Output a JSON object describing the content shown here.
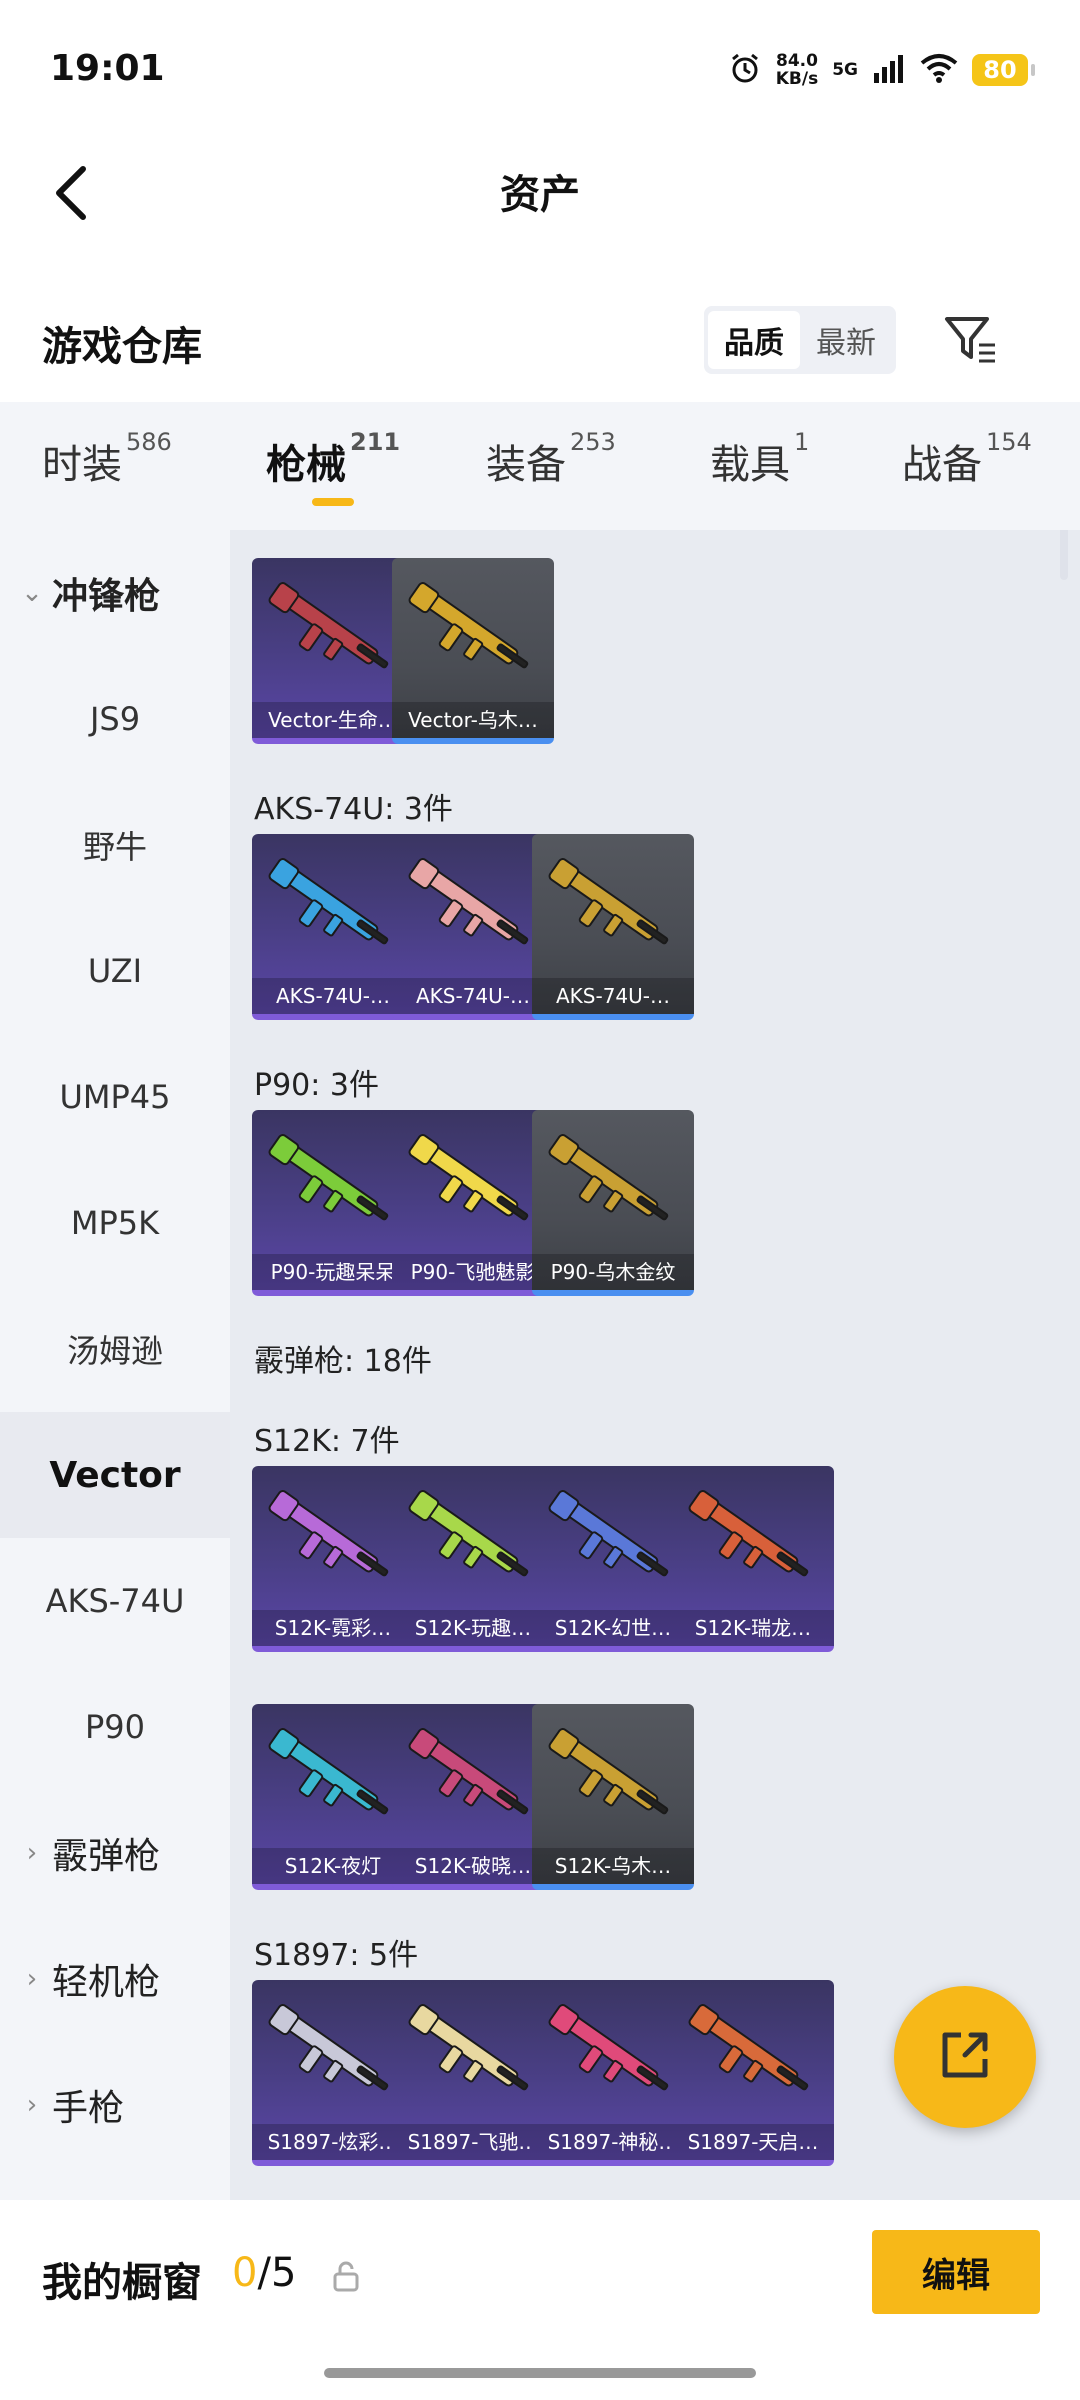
{
  "status_bar": {
    "time": "19:01",
    "net_speed_value": "84.0",
    "net_speed_unit": "KB/s",
    "network": "5G",
    "battery": "80",
    "icons": [
      "alarm-icon",
      "signal-icon",
      "wifi-icon",
      "battery-icon"
    ]
  },
  "header": {
    "title": "资产",
    "back_icon": "chevron-left-icon"
  },
  "warehouse": {
    "title": "游戏仓库",
    "sort_options": [
      "品质",
      "最新"
    ],
    "sort_active": "品质",
    "filter_icon": "filter-icon"
  },
  "tabs": [
    {
      "label": "时装",
      "count": "586"
    },
    {
      "label": "枪械",
      "count": "211",
      "active": true
    },
    {
      "label": "装备",
      "count": "253"
    },
    {
      "label": "载具",
      "count": "1"
    },
    {
      "label": "战备",
      "count": "154"
    }
  ],
  "sidebar": {
    "items": [
      {
        "label": "冲锋枪",
        "type": "group-expanded"
      },
      {
        "label": "JS9"
      },
      {
        "label": "野牛"
      },
      {
        "label": "UZI"
      },
      {
        "label": "UMP45"
      },
      {
        "label": "MP5K"
      },
      {
        "label": "汤姆逊"
      },
      {
        "label": "Vector",
        "selected": true
      },
      {
        "label": "AKS-74U"
      },
      {
        "label": "P90"
      },
      {
        "label": "霰弹枪",
        "type": "group-collapsed"
      },
      {
        "label": "轻机枪",
        "type": "group-collapsed"
      },
      {
        "label": "手枪",
        "type": "group-collapsed"
      }
    ]
  },
  "groups": [
    {
      "label": "",
      "items": [
        {
          "name": "Vector-生命…",
          "rarity": "epic",
          "color": "#b8424a"
        },
        {
          "name": "Vector-乌木…",
          "rarity": "gray",
          "color": "#d4a72c"
        }
      ]
    },
    {
      "label": "AKS-74U: 3件",
      "items": [
        {
          "name": "AKS-74U-…",
          "rarity": "epic",
          "color": "#3aa3e0"
        },
        {
          "name": "AKS-74U-…",
          "rarity": "epic",
          "color": "#e8a6a6"
        },
        {
          "name": "AKS-74U-…",
          "rarity": "gray",
          "color": "#c9a033"
        }
      ]
    },
    {
      "label": "P90: 3件",
      "items": [
        {
          "name": "P90-玩趣呆呆",
          "rarity": "epic",
          "color": "#7ccc3a"
        },
        {
          "name": "P90-飞驰魅影",
          "rarity": "epic",
          "color": "#f0d84a"
        },
        {
          "name": "P90-乌木金纹",
          "rarity": "gray",
          "color": "#c9a033"
        }
      ]
    },
    {
      "label": "霰弹枪: 18件",
      "items": []
    },
    {
      "label": "S12K: 7件",
      "items": [
        {
          "name": "S12K-霓彩…",
          "rarity": "epic",
          "color": "#b76ad8"
        },
        {
          "name": "S12K-玩趣…",
          "rarity": "epic",
          "color": "#a8d84a"
        },
        {
          "name": "S12K-幻世…",
          "rarity": "epic",
          "color": "#5a78d8"
        },
        {
          "name": "S12K-瑞龙…",
          "rarity": "epic",
          "color": "#d8603a"
        },
        {
          "name": "S12K-夜灯",
          "rarity": "epic",
          "color": "#3ab8d0"
        },
        {
          "name": "S12K-破晓…",
          "rarity": "epic",
          "color": "#c84a7a"
        },
        {
          "name": "S12K-乌木…",
          "rarity": "gray",
          "color": "#c9a033"
        }
      ]
    },
    {
      "label": "S1897: 5件",
      "items": [
        {
          "name": "S1897-炫彩…",
          "rarity": "epic",
          "color": "#c8c8d8"
        },
        {
          "name": "S1897-飞驰…",
          "rarity": "epic",
          "color": "#e8d8a0"
        },
        {
          "name": "S1897-神秘…",
          "rarity": "epic",
          "color": "#e04a7a"
        },
        {
          "name": "S1897-天启…",
          "rarity": "epic",
          "color": "#d86a3a"
        }
      ]
    }
  ],
  "fab": {
    "icon": "share-icon"
  },
  "showcase": {
    "label": "我的橱窗",
    "current": "0",
    "separator": "/",
    "max": "5",
    "lock_icon": "lock-icon",
    "edit_label": "编辑"
  }
}
